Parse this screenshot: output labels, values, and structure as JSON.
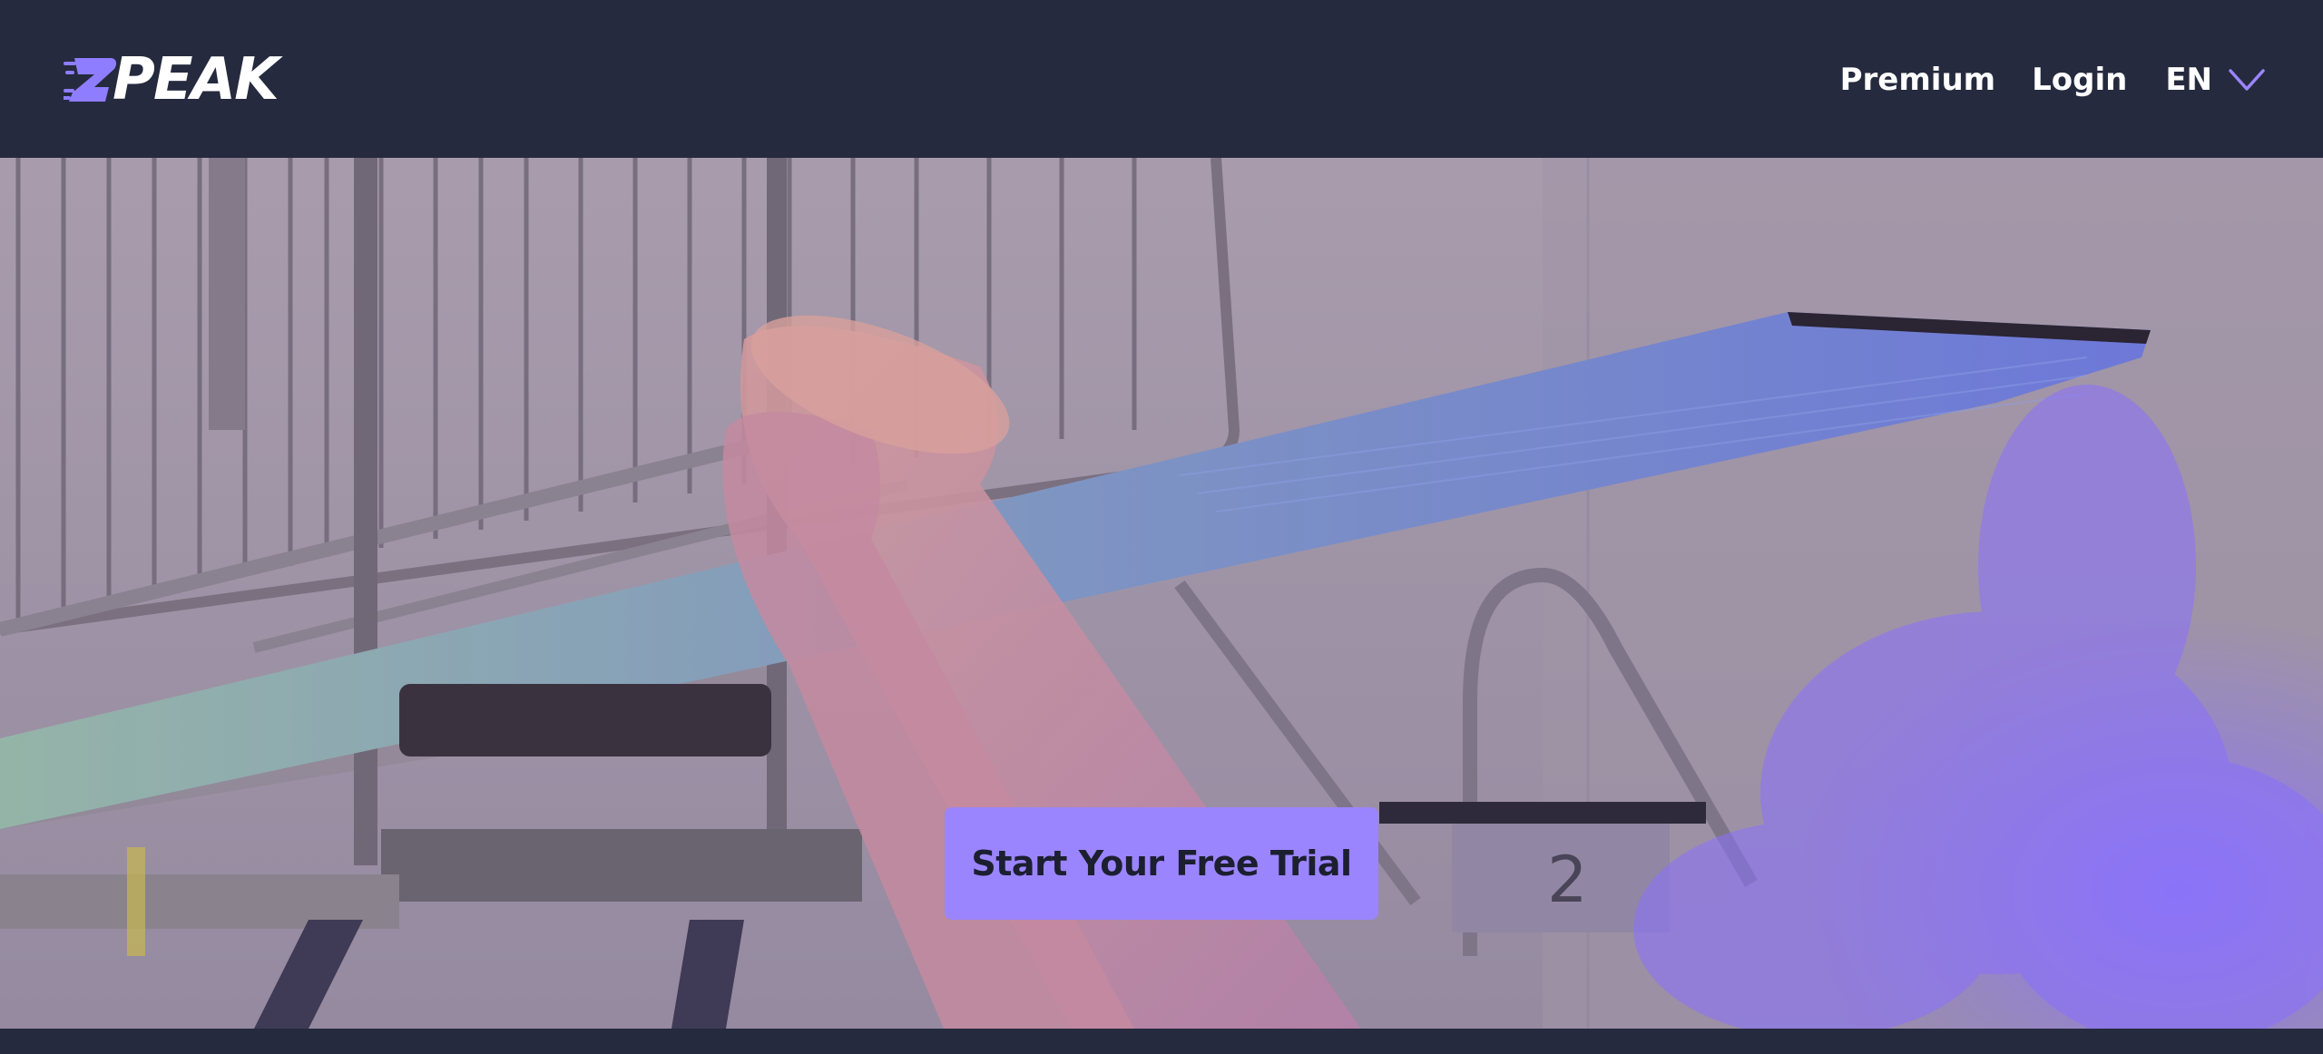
{
  "brand": {
    "logo_text": "PEAK",
    "logo_mark": "2",
    "accent_color": "#9b85ff"
  },
  "nav": {
    "premium_label": "Premium",
    "login_label": "Login",
    "language_code": "EN",
    "language_icon": "chevron-down-icon"
  },
  "hero": {
    "cta_label": "Start Your Free Trial",
    "background_description_icon": "diving-board-image"
  },
  "colors": {
    "header_bg": "#252a3e",
    "cta_bg": "#9b85ff",
    "cta_text": "#1c1f30"
  }
}
